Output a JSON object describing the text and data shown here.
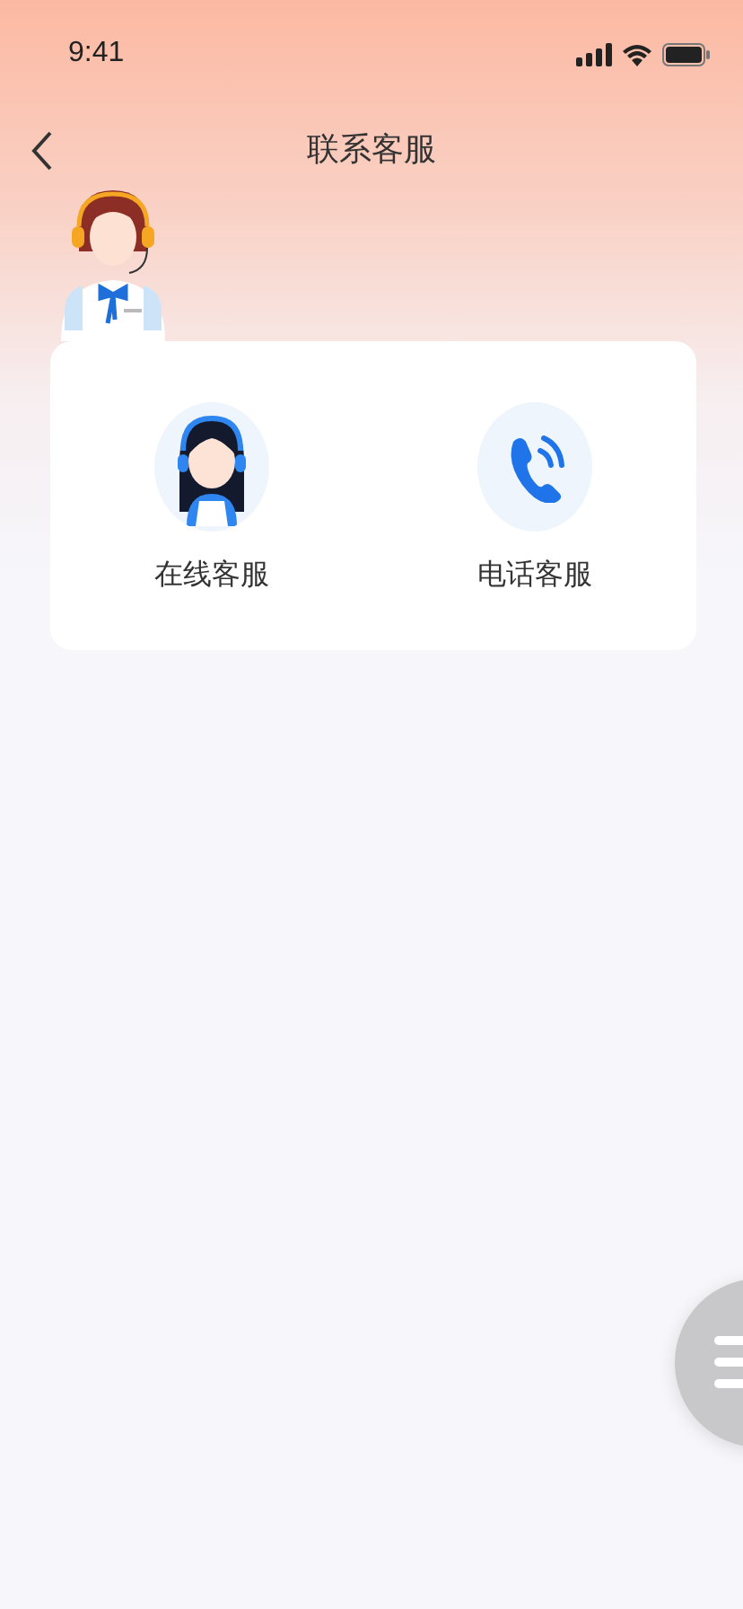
{
  "status_bar": {
    "time": "9:41"
  },
  "nav": {
    "title": "联系客服"
  },
  "services": [
    {
      "kind": "agent",
      "label": "在线客服"
    },
    {
      "kind": "phone",
      "label": "电话客服"
    }
  ]
}
